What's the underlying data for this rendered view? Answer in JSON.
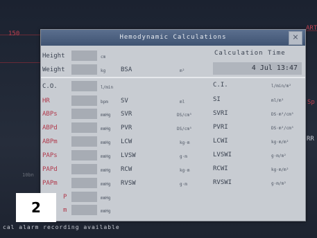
{
  "background": {
    "left_scale": "150",
    "right_labels": [
      "ART",
      "Sp",
      "RR"
    ],
    "left_lower": "10bn"
  },
  "dialog": {
    "title": "Hemodynamic Calculations",
    "close_symbol": "×",
    "calculation_time_label": "Calculation Time",
    "calculation_time_value": "4 Jul 13:47",
    "inputs": [
      {
        "label": "Height",
        "unit": "cm"
      },
      {
        "label": "Weight",
        "unit": "kg"
      },
      {
        "label": "C.O.",
        "unit": "l/min"
      },
      {
        "label": "HR",
        "unit": "bpm"
      },
      {
        "label": "ABPs",
        "unit": "mmHg"
      },
      {
        "label": "ABPd",
        "unit": "mmHg"
      },
      {
        "label": "ABPm",
        "unit": "mmHg"
      },
      {
        "label": "PAPs",
        "unit": "mmHg"
      },
      {
        "label": "PAPd",
        "unit": "mmHg"
      },
      {
        "label": "PAPm",
        "unit": "mmHg"
      },
      {
        "label": "P",
        "unit": "mmHg"
      },
      {
        "label": "m",
        "unit": "mmHg"
      }
    ],
    "bsa": {
      "label": "BSA",
      "unit": "m²"
    },
    "results_mid": [
      {
        "label": "SV",
        "unit": "ml"
      },
      {
        "label": "SVR",
        "unit": "DS/cm⁵"
      },
      {
        "label": "PVR",
        "unit": "DS/cm⁵"
      },
      {
        "label": "LCW",
        "unit": "kg·m"
      },
      {
        "label": "LVSW",
        "unit": "g·m"
      },
      {
        "label": "RCW",
        "unit": "kg·m"
      },
      {
        "label": "RVSW",
        "unit": "g·m"
      }
    ],
    "results_right": [
      {
        "label": "C.I.",
        "unit": "l/min/m²"
      },
      {
        "label": "SI",
        "unit": "ml/m²"
      },
      {
        "label": "SVRI",
        "unit": "DS·m²/cm⁵"
      },
      {
        "label": "PVRI",
        "unit": "DS·m²/cm⁵"
      },
      {
        "label": "LCWI",
        "unit": "kg·m/m²"
      },
      {
        "label": "LVSWI",
        "unit": "g·m/m²"
      },
      {
        "label": "RCWI",
        "unit": "kg·m/m²"
      },
      {
        "label": "RVSWI",
        "unit": "g·m/m²"
      }
    ]
  },
  "status_bar": "cal alarm recording available",
  "overlay_badge": "2"
}
